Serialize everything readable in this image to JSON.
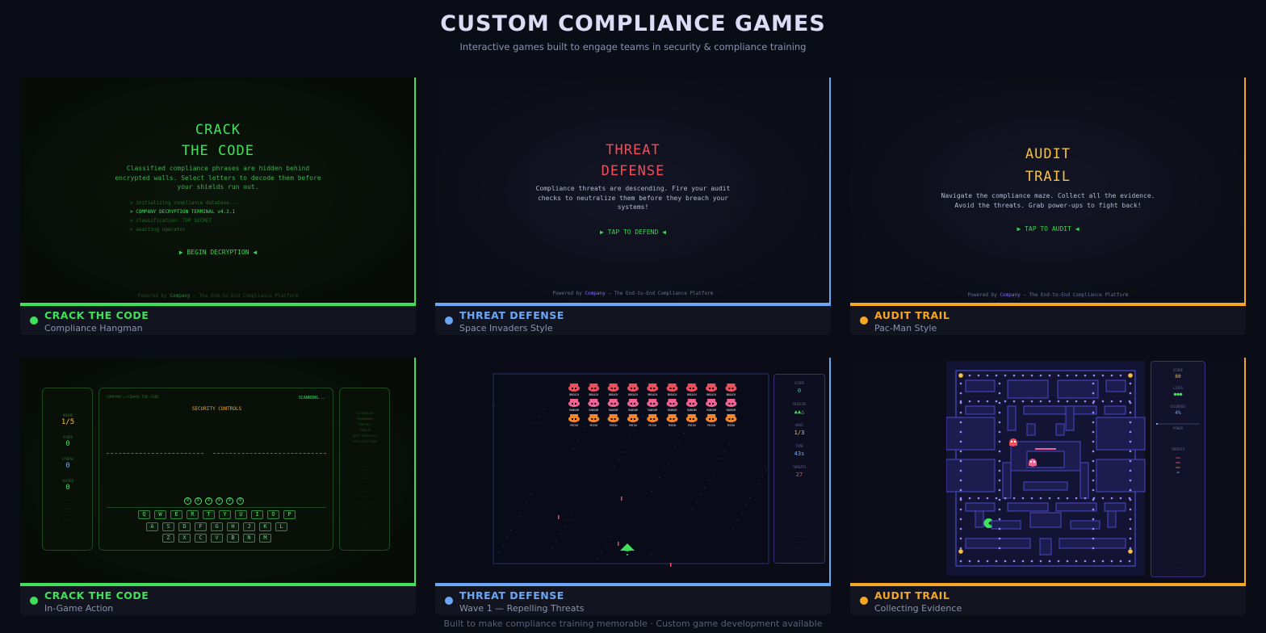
{
  "header": {
    "title": "CUSTOM COMPLIANCE GAMES",
    "subtitle": "Interactive games built to engage teams in security & compliance training"
  },
  "footer": "Built to make compliance training memorable · Custom game development available",
  "colors": {
    "green": "#3fe05a",
    "blue": "#6aa8f7",
    "orange": "#f5a623",
    "red": "#ef4e5a",
    "gold": "#f5c043"
  },
  "cards": [
    {
      "title": "CRACK THE CODE",
      "subtitle": "Compliance Hangman",
      "screen": {
        "title_line1": "CRACK",
        "title_line2": "THE CODE",
        "description": [
          "Classified compliance phrases are hidden behind",
          "encrypted walls. Select letters to decode them before",
          "your shields run out."
        ],
        "log": [
          "> initializing compliance database...",
          "> COMPANY DECRYPTION TERMINAL v4.2.1",
          "> classification: TOP SECRET",
          "> awaiting operator"
        ],
        "start": "▶ BEGIN DECRYPTION ◀",
        "powered_prefix": "Powered by",
        "company": "Company",
        "powered_suffix": "— The End-to-End Compliance Platform"
      }
    },
    {
      "title": "THREAT DEFENSE",
      "subtitle": "Space Invaders Style",
      "screen": {
        "title_line1": "THREAT",
        "title_line2": "DEFENSE",
        "description": [
          "Compliance threats are descending. Fire your audit",
          "checks to neutralize them before they breach your",
          "systems!"
        ],
        "start": "▶ TAP TO DEFEND ◀",
        "powered_prefix": "Powered by",
        "company": "Company",
        "powered_suffix": "— The End-to-End Compliance Platform"
      }
    },
    {
      "title": "AUDIT TRAIL",
      "subtitle": "Pac-Man Style",
      "screen": {
        "title_line1": "AUDIT",
        "title_line2": "TRAIL",
        "description": [
          "Navigate the compliance maze. Collect all the evidence.",
          "Avoid the threats. Grab power-ups to fight back!"
        ],
        "start": "▶ TAP TO AUDIT ◀",
        "powered_prefix": "Powered by",
        "company": "Company",
        "powered_suffix": "— The End-to-End Compliance Platform"
      }
    },
    {
      "title": "CRACK THE CODE",
      "subtitle": "In-Game Action",
      "screen": {
        "terminal_label": "COMPANY://CRACK-THE-CODE",
        "status": "SCANNING...",
        "category": "SECURITY CONTROLS",
        "stats": [
          {
            "label": "ROUND",
            "value": "1/5"
          },
          {
            "label": "SCORE",
            "value": "0"
          },
          {
            "label": "STREAK",
            "value": "0"
          },
          {
            "label": "SOLVED",
            "value": "0"
          }
        ],
        "shield_icon": "shield-icon",
        "shields_remaining": 6,
        "keyboard": [
          [
            "Q",
            "W",
            "E",
            "R",
            "T",
            "Y",
            "U",
            "I",
            "O",
            "P"
          ],
          [
            "A",
            "S",
            "D",
            "F",
            "G",
            "H",
            "J",
            "K",
            "L"
          ],
          [
            "Z",
            "X",
            "C",
            "V",
            "B",
            "N",
            "M"
          ]
        ],
        "categories": [
          "CATEGORIES",
          "FRAMEWORKS",
          "CONTROLS",
          "THREATS",
          "BEST PRACTICES",
          "CERTIFICATIONS"
        ]
      }
    },
    {
      "title": "THREAT DEFENSE",
      "subtitle": "Wave 1 — Repelling Threats",
      "screen": {
        "aliens": {
          "rows": [
            {
              "label": "BREACH",
              "color": "#ef4e5a",
              "count": 9
            },
            {
              "label": "RANSOM",
              "color": "#f06292",
              "count": 9
            },
            {
              "label": "PHISH",
              "color": "#f5852a",
              "count": 9
            }
          ]
        },
        "stats": [
          {
            "label": "SCORE",
            "value": "0",
            "color": "#3fd0c0"
          },
          {
            "label": "SHIELDS",
            "value": "▲▲△",
            "color": "#3fe05a"
          },
          {
            "label": "WAVE",
            "value": "1/3",
            "color": "#f5c043"
          },
          {
            "label": "TIME",
            "value": "43s",
            "color": "#6aa8f7"
          },
          {
            "label": "THREATS",
            "value": "27",
            "color": "#ef4e5a"
          }
        ]
      }
    },
    {
      "title": "AUDIT TRAIL",
      "subtitle": "Collecting Evidence",
      "screen": {
        "stats": [
          {
            "label": "SCORE",
            "value": "60",
            "color": "#f5c043"
          },
          {
            "label": "LIVES",
            "value": "●●●",
            "color": "#3fe05a"
          },
          {
            "label": "EVIDENCE",
            "value": "4%",
            "color": "#6aa8f7"
          },
          {
            "label": "POWER",
            "value": "",
            "color": "#8d92b0"
          },
          {
            "label": "THREATS",
            "value": "",
            "color": "#8d92b0"
          }
        ],
        "evidence_progress": 0.04
      }
    }
  ]
}
